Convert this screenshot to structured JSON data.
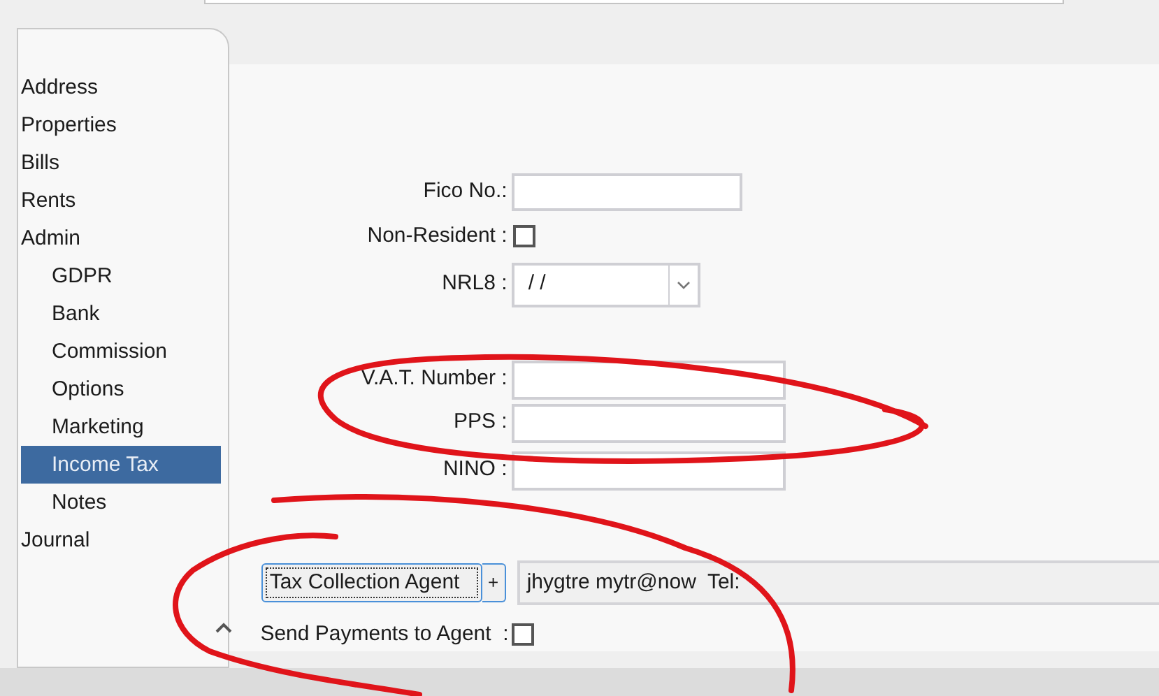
{
  "sidebar": {
    "items": [
      {
        "label": "Address",
        "selected": false
      },
      {
        "label": "Properties",
        "selected": false
      },
      {
        "label": "Bills",
        "selected": false
      },
      {
        "label": "Rents",
        "selected": false
      },
      {
        "label": "Admin",
        "selected": false,
        "children": [
          {
            "label": "GDPR",
            "selected": false
          },
          {
            "label": "Bank",
            "selected": false
          },
          {
            "label": "Commission",
            "selected": false
          },
          {
            "label": "Options",
            "selected": false
          },
          {
            "label": "Marketing",
            "selected": false
          },
          {
            "label": "Income Tax",
            "selected": true
          },
          {
            "label": "Notes",
            "selected": false
          }
        ]
      },
      {
        "label": "Journal",
        "selected": false
      }
    ]
  },
  "form": {
    "fields": [
      {
        "kind": "text",
        "label": "Fico No.:"
      },
      {
        "kind": "checkbox",
        "label": "Non-Resident :",
        "checked": false
      },
      {
        "kind": "select",
        "label": "NRL8 :",
        "value": "/ /"
      },
      {
        "kind": "wide",
        "label": "V.A.T. Number :"
      },
      {
        "kind": "wide",
        "label": "PPS :"
      },
      {
        "kind": "wide",
        "label": "NINO :"
      }
    ]
  },
  "agent": {
    "button": "Tax Collection Agent",
    "plus": "+",
    "value": "jhygtre mytr@now  Tel:"
  },
  "send_payments": {
    "label": "Send Payments to Agent  :",
    "checked": false
  }
}
